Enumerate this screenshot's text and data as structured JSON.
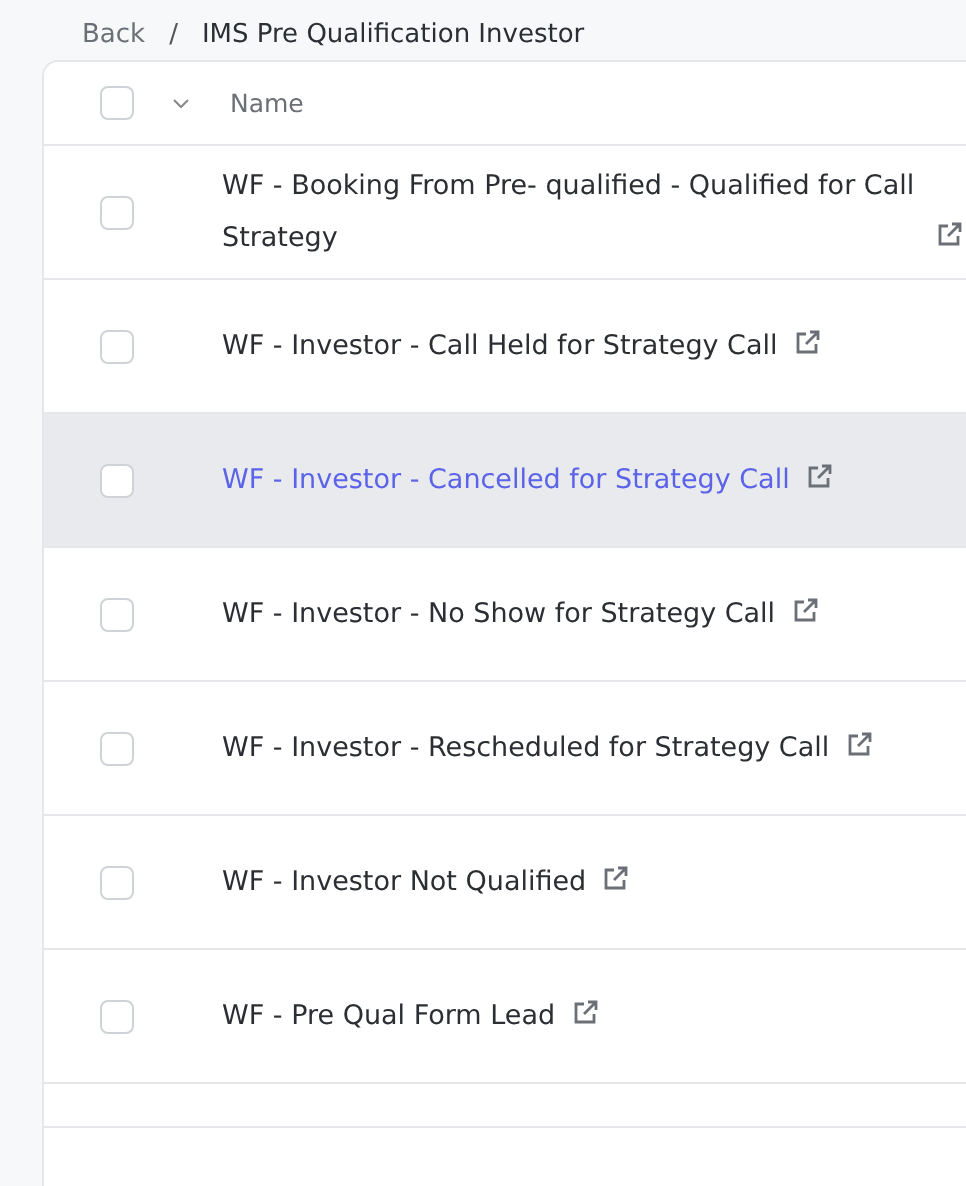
{
  "breadcrumb": {
    "back": "Back",
    "separator": "/",
    "current": "IMS Pre Qualification Investor"
  },
  "table": {
    "select_all_checked": false,
    "columns": [
      {
        "label": "Name"
      }
    ],
    "rows": [
      {
        "name": "WF - Booking From Pre- qualified - Qualified for Call Strategy",
        "checked": false,
        "highlighted": false
      },
      {
        "name": "WF - Investor - Call Held for Strategy Call",
        "checked": false,
        "highlighted": false
      },
      {
        "name": "WF - Investor - Cancelled for Strategy Call",
        "checked": false,
        "highlighted": true
      },
      {
        "name": "WF - Investor - No Show for Strategy Call",
        "checked": false,
        "highlighted": false
      },
      {
        "name": "WF - Investor - Rescheduled for Strategy Call",
        "checked": false,
        "highlighted": false
      },
      {
        "name": "WF - Investor Not Qualified",
        "checked": false,
        "highlighted": false
      },
      {
        "name": "WF - Pre Qual Form Lead",
        "checked": false,
        "highlighted": false
      }
    ]
  }
}
